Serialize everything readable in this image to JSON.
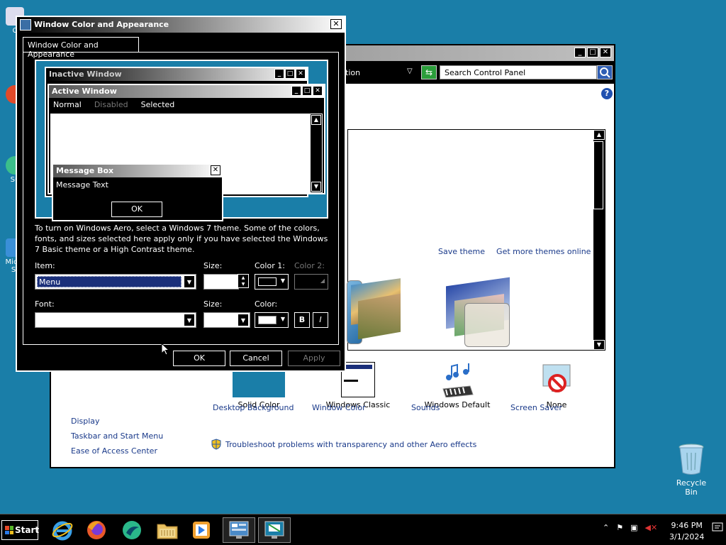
{
  "desktop": {
    "left_icon_labels": [
      "C",
      "Su",
      "Micro St"
    ],
    "recycle_bin": "Recycle Bin"
  },
  "control_panel": {
    "breadcrumb_tail": "ition",
    "search_placeholder": "Search Control Panel",
    "help": "?",
    "save_theme": "Save theme",
    "more_themes": "Get more themes online",
    "see_also_links": [
      "Display",
      "Taskbar and Start Menu",
      "Ease of Access Center"
    ],
    "items": [
      {
        "label": "Desktop Background",
        "value": "Solid Color"
      },
      {
        "label": "Window Color",
        "value": "Windows Classic"
      },
      {
        "label": "Sounds",
        "value": "Windows Default"
      },
      {
        "label": "Screen Saver",
        "value": "None"
      }
    ],
    "troubleshoot": "Troubleshoot problems with transparency and other Aero effects"
  },
  "dialog": {
    "title": "Window Color and Appearance",
    "close": "✕",
    "tab": "Window Color and Appearance",
    "preview": {
      "inactive_title": "Inactive Window",
      "active_title": "Active Window",
      "menu_normal": "Normal",
      "menu_disabled": "Disabled",
      "menu_selected": "Selected",
      "msgbox_title": "Message Box",
      "msgbox_text": "Message Text",
      "msgbox_ok": "OK"
    },
    "info_text": "To turn on Windows Aero, select a Windows 7 theme.  Some of the colors, fonts, and sizes selected here apply only if you have selected the Windows 7 Basic theme or a High Contrast theme.",
    "item_label": "Item:",
    "item_value": "Menu",
    "size_label": "Size:",
    "color1_label": "Color 1:",
    "color2_label": "Color 2:",
    "font_label": "Font:",
    "font_size_label": "Size:",
    "font_color_label": "Color:",
    "bold": "B",
    "italic": "I",
    "ok": "OK",
    "cancel": "Cancel",
    "apply": "Apply"
  },
  "taskbar": {
    "start": "Start",
    "time": "9:46 PM",
    "date": "3/1/2024"
  },
  "colors": {
    "desktop": "#1a7ea8",
    "selection": "#1a2f7a",
    "link": "#1a3a8a"
  }
}
